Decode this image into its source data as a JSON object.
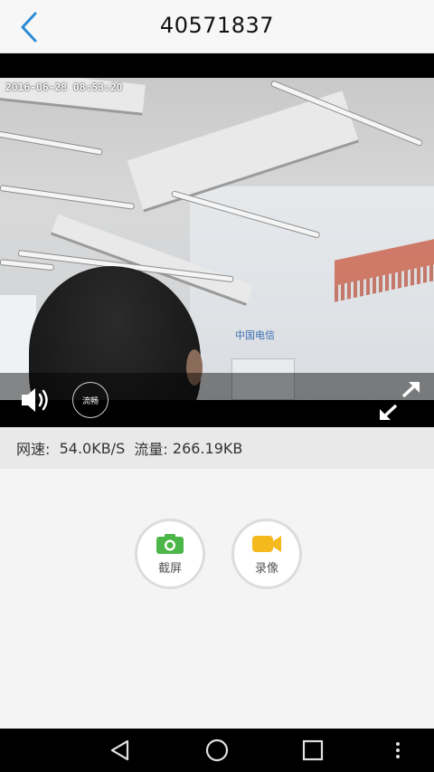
{
  "header": {
    "title": "40571837",
    "back_icon": "chevron-left-icon"
  },
  "video": {
    "timestamp": "2016-06-28 08:53:20",
    "quality_label": "流畅",
    "volume_icon": "speaker-icon",
    "fullscreen_icon": "expand-arrows-icon"
  },
  "stats": {
    "speed_label": "网速:",
    "speed_value": "54.0KB/S",
    "traffic_label": "流量:",
    "traffic_value": "266.19KB"
  },
  "actions": {
    "screenshot_label": "截屏",
    "screenshot_icon": "camera-icon",
    "record_label": "录像",
    "record_icon": "video-camera-icon"
  },
  "colors": {
    "accent_blue": "#2a8ad4",
    "screenshot_green": "#4cb648",
    "record_yellow": "#f5b91e"
  },
  "navbar": {
    "back": "nav-back-icon",
    "home": "nav-home-icon",
    "recents": "nav-recents-icon",
    "menu": "nav-menu-icon"
  }
}
